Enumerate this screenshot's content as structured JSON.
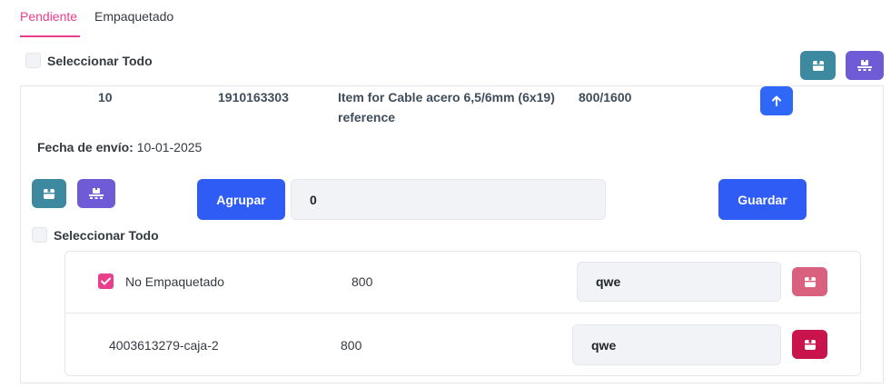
{
  "tabs": [
    {
      "label": "Pendiente",
      "active": true
    },
    {
      "label": "Empaquetado",
      "active": false
    }
  ],
  "header": {
    "select_all_label": "Seleccionar Todo",
    "select_all_checked": false,
    "box_button_icon": "box-icon",
    "pallet_button_icon": "pallet-icon"
  },
  "order": {
    "line": "10",
    "material": "1910163303",
    "description": "Item for Cable acero 6,5/6mm (6x19) reference",
    "quantity": "800/1600",
    "toggle_icon": "arrow-up-icon",
    "ship_date_label": "Fecha de envío:",
    "ship_date_value": "10-01-2025",
    "group_button_label": "Agrupar",
    "group_input_value": "0",
    "save_button_label": "Guardar",
    "select_all_label": "Seleccionar Todo",
    "select_all_checked": false
  },
  "items": [
    {
      "checked": true,
      "name": "No Empaquetado",
      "qty": "800",
      "input_value": "qwe",
      "action_icon": "box-icon"
    },
    {
      "checked": false,
      "name": "4003613279-caja-2",
      "qty": "800",
      "input_value": "qwe",
      "action_icon": "box-icon"
    }
  ],
  "colors": {
    "accent": "#e83e8c",
    "primary": "#2f5cf5",
    "teal": "#3d8aa0",
    "purple": "#6f5bd6",
    "pink": "#d9607f",
    "crimson": "#c8134c"
  }
}
